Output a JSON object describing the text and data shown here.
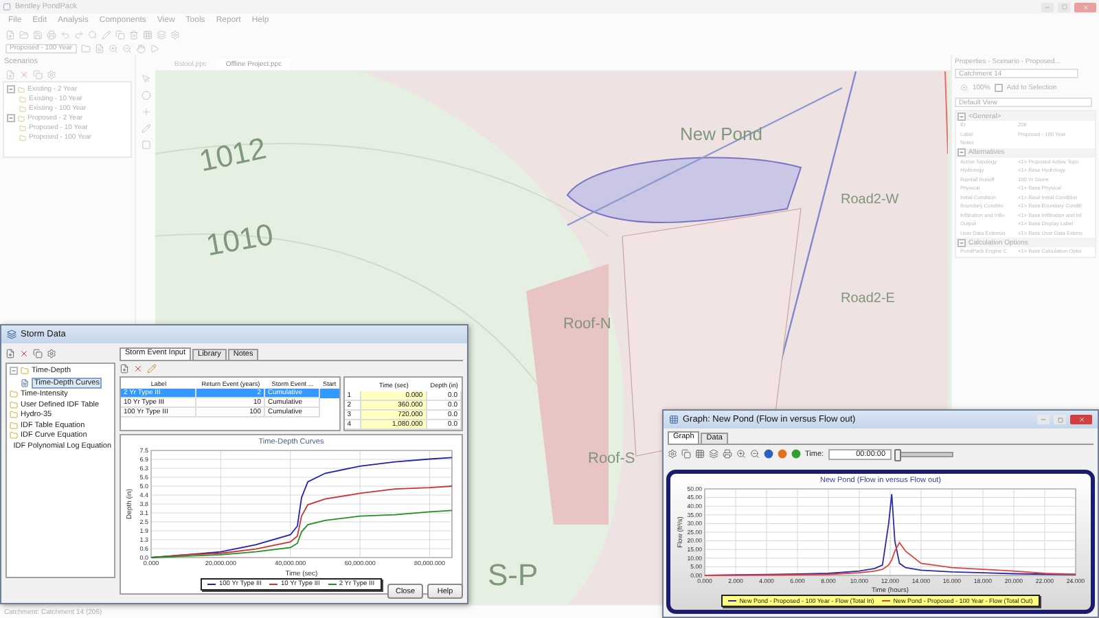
{
  "window": {
    "title": "Bentley PondPack"
  },
  "menu": [
    "File",
    "Edit",
    "Analysis",
    "Components",
    "View",
    "Tools",
    "Report",
    "Help"
  ],
  "toolbar": {
    "scenario": "Proposed - 100 Year"
  },
  "scenarios_panel": {
    "title": "Scenarios",
    "tree": [
      {
        "label": "Existing - 2 Year",
        "expanded": true,
        "children": [
          {
            "label": "Existing - 10 Year"
          },
          {
            "label": "Existing - 100 Year"
          }
        ]
      },
      {
        "label": "Proposed - 2 Year",
        "expanded": true,
        "children": [
          {
            "label": "Proposed - 10 Year"
          },
          {
            "label": "Proposed - 100 Year"
          }
        ]
      }
    ]
  },
  "document_tabs": [
    {
      "label": "Bstool.ppc",
      "selected": false
    },
    {
      "label": "Offline Project.ppc",
      "selected": true
    }
  ],
  "map": {
    "labels": [
      "1012",
      "1010",
      "New Pond",
      "Road2-W",
      "Road2-E",
      "Roof-N",
      "Roof-S",
      "S-P"
    ]
  },
  "properties": {
    "title": "Properties - Scenario - Proposed...",
    "element": "Catchment 14",
    "zoom": "100%",
    "add_to_selection": {
      "label": "Add to Selection",
      "checked": false
    },
    "view": "Default View",
    "sections": [
      {
        "label": "<General>",
        "expanded": true,
        "rows": [
          {
            "name": "ID",
            "value": "206"
          },
          {
            "name": "Label",
            "value": "Proposed - 100 Year"
          },
          {
            "name": "Notes"
          }
        ]
      },
      {
        "label": "Alternatives",
        "expanded": true,
        "rows": [
          {
            "name": "Active Topology",
            "value": "<1> Proposed Active Topo"
          },
          {
            "name": "Hydrology",
            "value": "<1> Base Hydrology"
          },
          {
            "name": "Rainfall Runoff",
            "value": "100 Yr Storm"
          },
          {
            "name": "Physical",
            "value": "<1> Base Physical"
          },
          {
            "name": "Initial Condition",
            "value": "<1> Base Initial Condition"
          },
          {
            "name": "Boundary Conditio",
            "value": "<1> Base Boundary Conditi"
          },
          {
            "name": "Infiltration and Inflo",
            "value": "<1> Base Infiltration and Inf"
          },
          {
            "name": "Output",
            "value": "<1> Base Display Label"
          },
          {
            "name": "User Data Extensio",
            "value": "<1> Base User Data Extens"
          }
        ]
      },
      {
        "label": "Calculation Options",
        "expanded": true,
        "rows": [
          {
            "name": "PondPack Engine C",
            "value": "<1> Base Calculation Optio"
          }
        ]
      }
    ]
  },
  "status_bar": "Catchment: Catchment 14 (206)",
  "storm_data": {
    "title": "Storm Data",
    "tree": [
      {
        "label": "Time-Depth",
        "expanded": true,
        "children": [
          {
            "label": "Time-Depth Curves",
            "selected": true
          }
        ]
      },
      {
        "label": "Time-Intensity"
      },
      {
        "label": "User Defined IDF Table"
      },
      {
        "label": "Hydro-35"
      },
      {
        "label": "IDF Table Equation"
      },
      {
        "label": "IDF Curve Equation"
      },
      {
        "label": "IDF Polynomial Log Equation"
      }
    ],
    "tabs": [
      {
        "label": "Storm Event Input",
        "selected": true
      },
      {
        "label": "Library",
        "selected": false
      },
      {
        "label": "Notes",
        "selected": false
      }
    ],
    "events_table": {
      "columns": [
        "Label",
        "Return Event (years)",
        "Storm Event ...",
        "Start"
      ],
      "rows": [
        {
          "label": "2 Yr Type III",
          "return_event": "2",
          "storm_event": "Cumulative",
          "selected": true
        },
        {
          "label": "10 Yr Type III",
          "return_event": "10",
          "storm_event": "Cumulative",
          "selected": false
        },
        {
          "label": "100 Yr Type III",
          "return_event": "100",
          "storm_event": "Cumulative",
          "selected": false
        }
      ]
    },
    "depth_table": {
      "columns": [
        "Time (sec)",
        "Depth (in)"
      ],
      "rows": [
        {
          "index": "1",
          "time": "0.000",
          "depth": "0.0"
        },
        {
          "index": "2",
          "time": "360.000",
          "depth": "0.0"
        },
        {
          "index": "3",
          "time": "720.000",
          "depth": "0.0"
        },
        {
          "index": "4",
          "time": "1,080.000",
          "depth": "0.0"
        }
      ]
    },
    "chart_data": {
      "type": "line",
      "title": "Time-Depth Curves",
      "xlabel": "Time (sec)",
      "ylabel": "Depth (in)",
      "x": [
        0,
        10000,
        20000,
        30000,
        40000,
        42000,
        43200,
        45000,
        50000,
        60000,
        70000,
        80000,
        86400
      ],
      "series": [
        {
          "name": "100 Yr Type III",
          "color": "#1f1fb4",
          "values": [
            0,
            0.2,
            0.4,
            0.9,
            1.6,
            2.2,
            4.2,
            5.3,
            5.9,
            6.4,
            6.7,
            6.9,
            7.0
          ]
        },
        {
          "name": "10 Yr Type III",
          "color": "#d03030",
          "values": [
            0,
            0.2,
            0.3,
            0.6,
            1.1,
            1.5,
            2.9,
            3.7,
            4.1,
            4.5,
            4.8,
            4.9,
            5.0
          ]
        },
        {
          "name": "2 Yr Type III",
          "color": "#209020",
          "values": [
            0,
            0.1,
            0.2,
            0.4,
            0.7,
            1.0,
            1.8,
            2.3,
            2.6,
            2.9,
            3.0,
            3.2,
            3.3
          ]
        }
      ],
      "xlim": [
        0,
        86400
      ],
      "ylim": [
        0,
        7.5
      ],
      "grid": true,
      "xticks": [
        {
          "value": 0,
          "label": "0.000"
        },
        {
          "value": 20000,
          "label": "20,000.000"
        },
        {
          "value": 40000,
          "label": "40,000.000"
        },
        {
          "value": 60000,
          "label": "60,000.000"
        },
        {
          "value": 80000,
          "label": "80,000.000"
        }
      ],
      "yticks": [
        {
          "value": 0,
          "label": "0.0"
        },
        {
          "value": 0.625,
          "label": "0.6"
        },
        {
          "value": 1.25,
          "label": "1.3"
        },
        {
          "value": 1.875,
          "label": "1.9"
        },
        {
          "value": 2.5,
          "label": "2.5"
        },
        {
          "value": 3.125,
          "label": "3.1"
        },
        {
          "value": 3.75,
          "label": "3.8"
        },
        {
          "value": 4.375,
          "label": "4.4"
        },
        {
          "value": 5,
          "label": "5.0"
        },
        {
          "value": 5.625,
          "label": "5.6"
        },
        {
          "value": 6.25,
          "label": "6.3"
        },
        {
          "value": 6.875,
          "label": "6.9"
        },
        {
          "value": 7.5,
          "label": "7.5"
        }
      ]
    },
    "buttons": [
      "Close",
      "Help"
    ]
  },
  "graph": {
    "title": "Graph: New Pond (Flow in versus Flow out)",
    "tabs": [
      {
        "label": "Graph",
        "selected": true
      },
      {
        "label": "Data",
        "selected": false
      }
    ],
    "time_label": "Time:",
    "time_value": "00:00:00",
    "time_slider": {
      "level": 0
    },
    "chart_data": {
      "type": "line",
      "title": "New Pond (Flow in versus Flow out)",
      "xlabel": "Time (hours)",
      "ylabel": "Flow (ft³/s)",
      "x": [
        0,
        2,
        4,
        6,
        8,
        10,
        11,
        11.5,
        11.9,
        12.1,
        12.3,
        12.6,
        13,
        14,
        16,
        18,
        20,
        22,
        24
      ],
      "series": [
        {
          "name": "New Pond - Proposed - 100 Year - Flow (Total In)",
          "color": "#2a2aa8",
          "values": [
            0,
            0.3,
            0.5,
            0.8,
            1.2,
            2.5,
            4,
            6,
            30,
            47,
            20,
            7,
            4.5,
            3,
            2,
            1.5,
            1,
            0.7,
            0.5
          ]
        },
        {
          "name": "New Pond - Proposed - 100 Year - Flow (Total Out)",
          "color": "#e04040",
          "values": [
            0,
            0.1,
            0.2,
            0.4,
            0.6,
            1.5,
            2.5,
            3.5,
            6,
            9,
            14,
            19,
            14,
            7,
            4.5,
            3.5,
            2.5,
            1.2,
            0.7
          ]
        }
      ],
      "xlim": [
        0,
        24
      ],
      "ylim": [
        0,
        50
      ],
      "grid": true,
      "xticks": [
        {
          "value": 0,
          "label": "0.000"
        },
        {
          "value": 2,
          "label": "2.000"
        },
        {
          "value": 4,
          "label": "4.000"
        },
        {
          "value": 6,
          "label": "6.000"
        },
        {
          "value": 8,
          "label": "8.000"
        },
        {
          "value": 10,
          "label": "10.000"
        },
        {
          "value": 12,
          "label": "12.000"
        },
        {
          "value": 14,
          "label": "14.000"
        },
        {
          "value": 16,
          "label": "16.000"
        },
        {
          "value": 18,
          "label": "18.000"
        },
        {
          "value": 20,
          "label": "20.000"
        },
        {
          "value": 22,
          "label": "22.000"
        },
        {
          "value": 24,
          "label": "24.000"
        }
      ],
      "yticks": [
        {
          "value": 0,
          "label": "0.00"
        },
        {
          "value": 5,
          "label": "5.00"
        },
        {
          "value": 10,
          "label": "10.00"
        },
        {
          "value": 15,
          "label": "15.00"
        },
        {
          "value": 20,
          "label": "20.00"
        },
        {
          "value": 25,
          "label": "25.00"
        },
        {
          "value": 30,
          "label": "30.00"
        },
        {
          "value": 35,
          "label": "35.00"
        },
        {
          "value": 40,
          "label": "40.00"
        },
        {
          "value": 45,
          "label": "45.00"
        },
        {
          "value": 50,
          "label": "50.00"
        }
      ]
    }
  }
}
